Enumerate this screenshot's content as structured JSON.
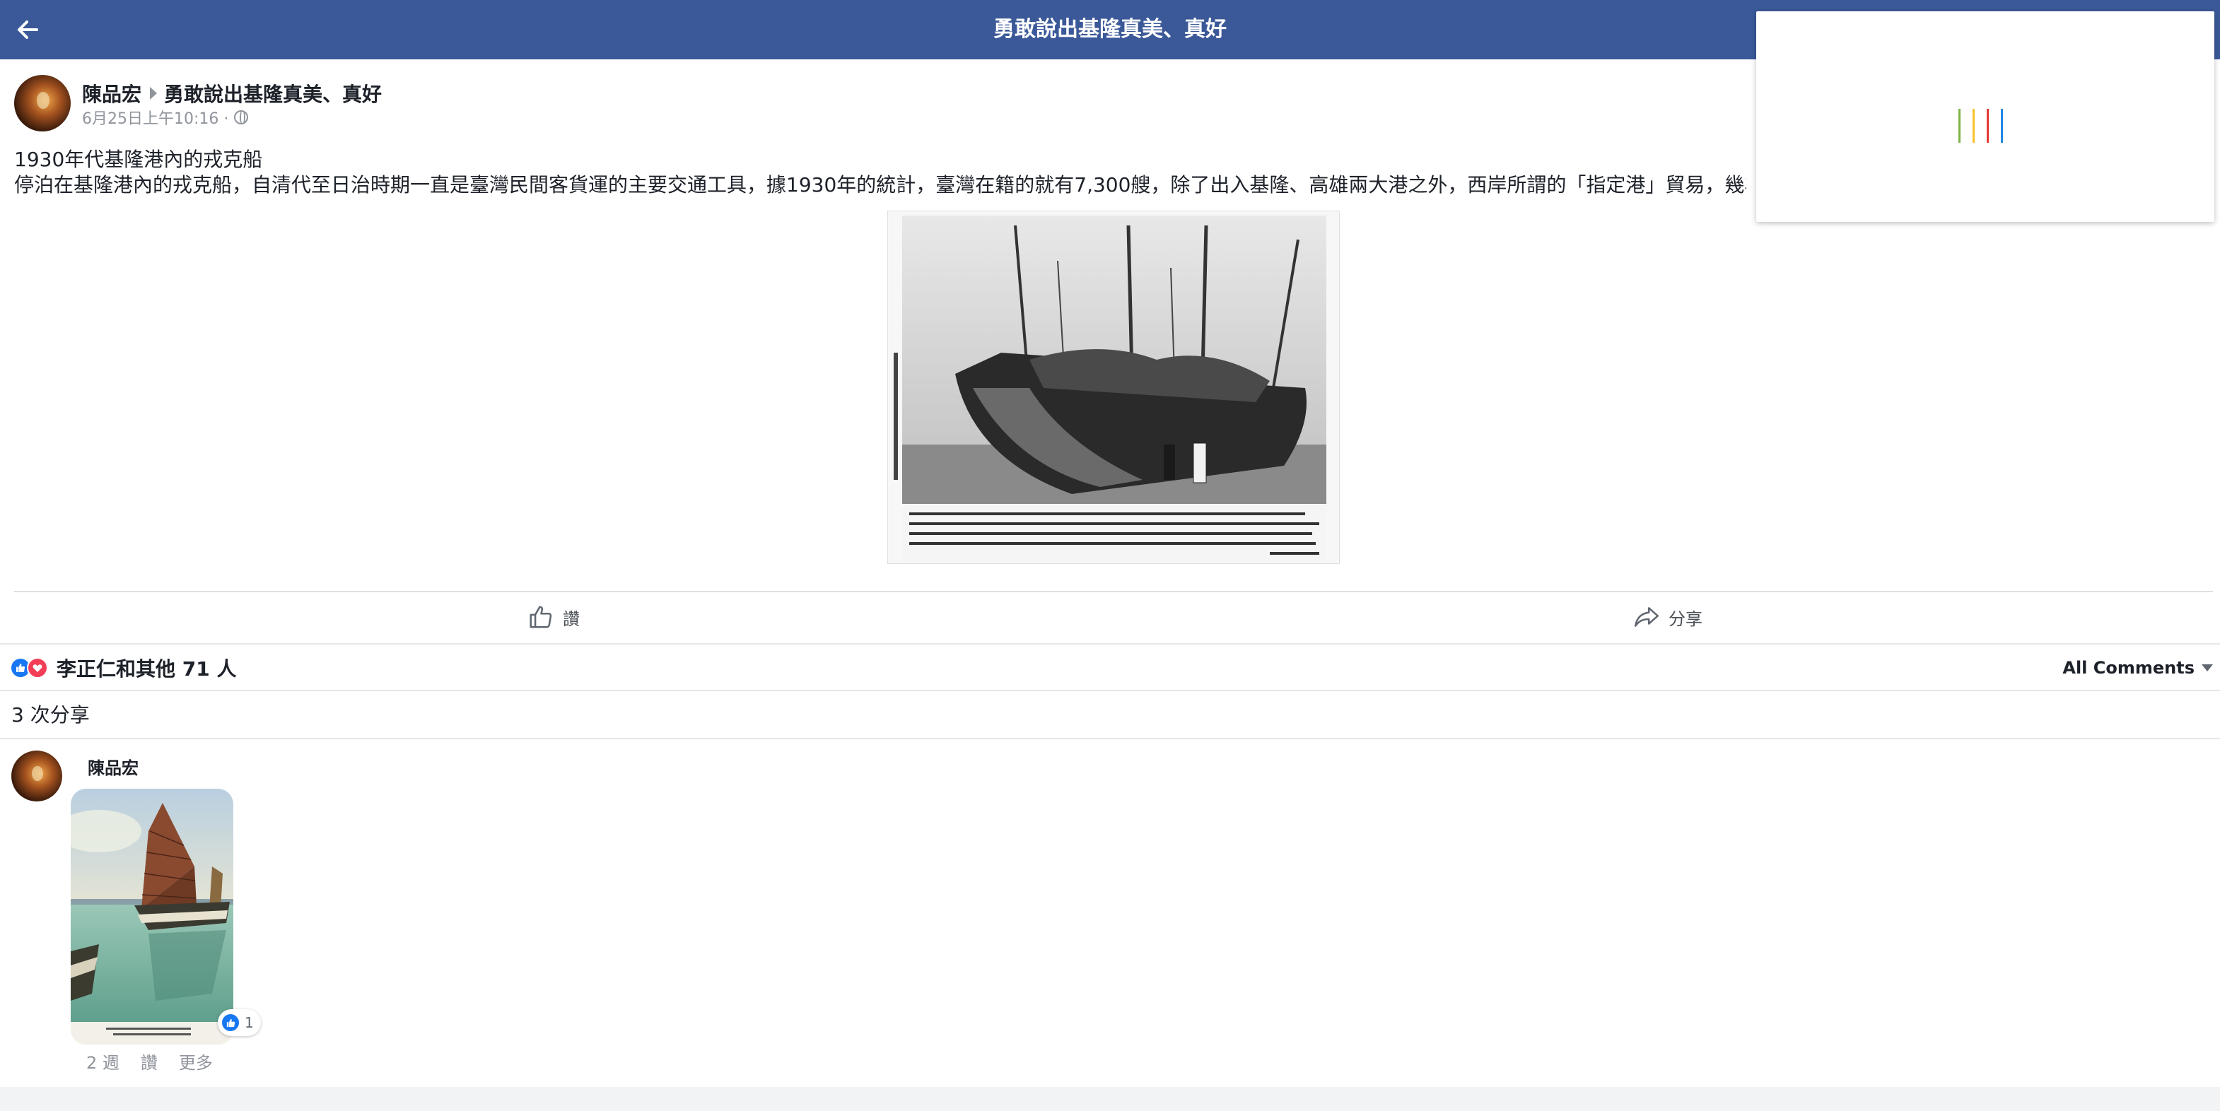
{
  "topbar": {
    "title": "勇敢說出基隆真美、真好",
    "back_icon": "arrow-left-icon",
    "background": "#3b5998"
  },
  "loading_popup": {
    "spinner_colors": [
      "#7cb342",
      "#fbc02d",
      "#e53935",
      "#1e88e5"
    ]
  },
  "post": {
    "author": "陳品宏",
    "group": "勇敢說出基隆真美、真好",
    "timestamp": "6月25日上午10:16 ·",
    "text_line1": "1930年代基隆港內的戎克船",
    "text_line2": "停泊在基隆港內的戎克船，自清代至日治時期一直是臺灣民間客貨運的主要交通工具，據1930年的統計，臺灣在籍的就有7,300艘，除了出入基隆、高雄兩大港之外，西岸所謂的「指定港」貿易，幾為其",
    "actions": {
      "like_label": "讚",
      "share_label": "分享"
    },
    "reactions_summary": "李正仁和其他 71 人",
    "all_comments_label": "All Comments",
    "shares_count": "3 次分享"
  },
  "comment": {
    "author": "陳品宏",
    "like_count": "1",
    "time": "2 週",
    "like_label": "讚",
    "more_label": "更多"
  }
}
